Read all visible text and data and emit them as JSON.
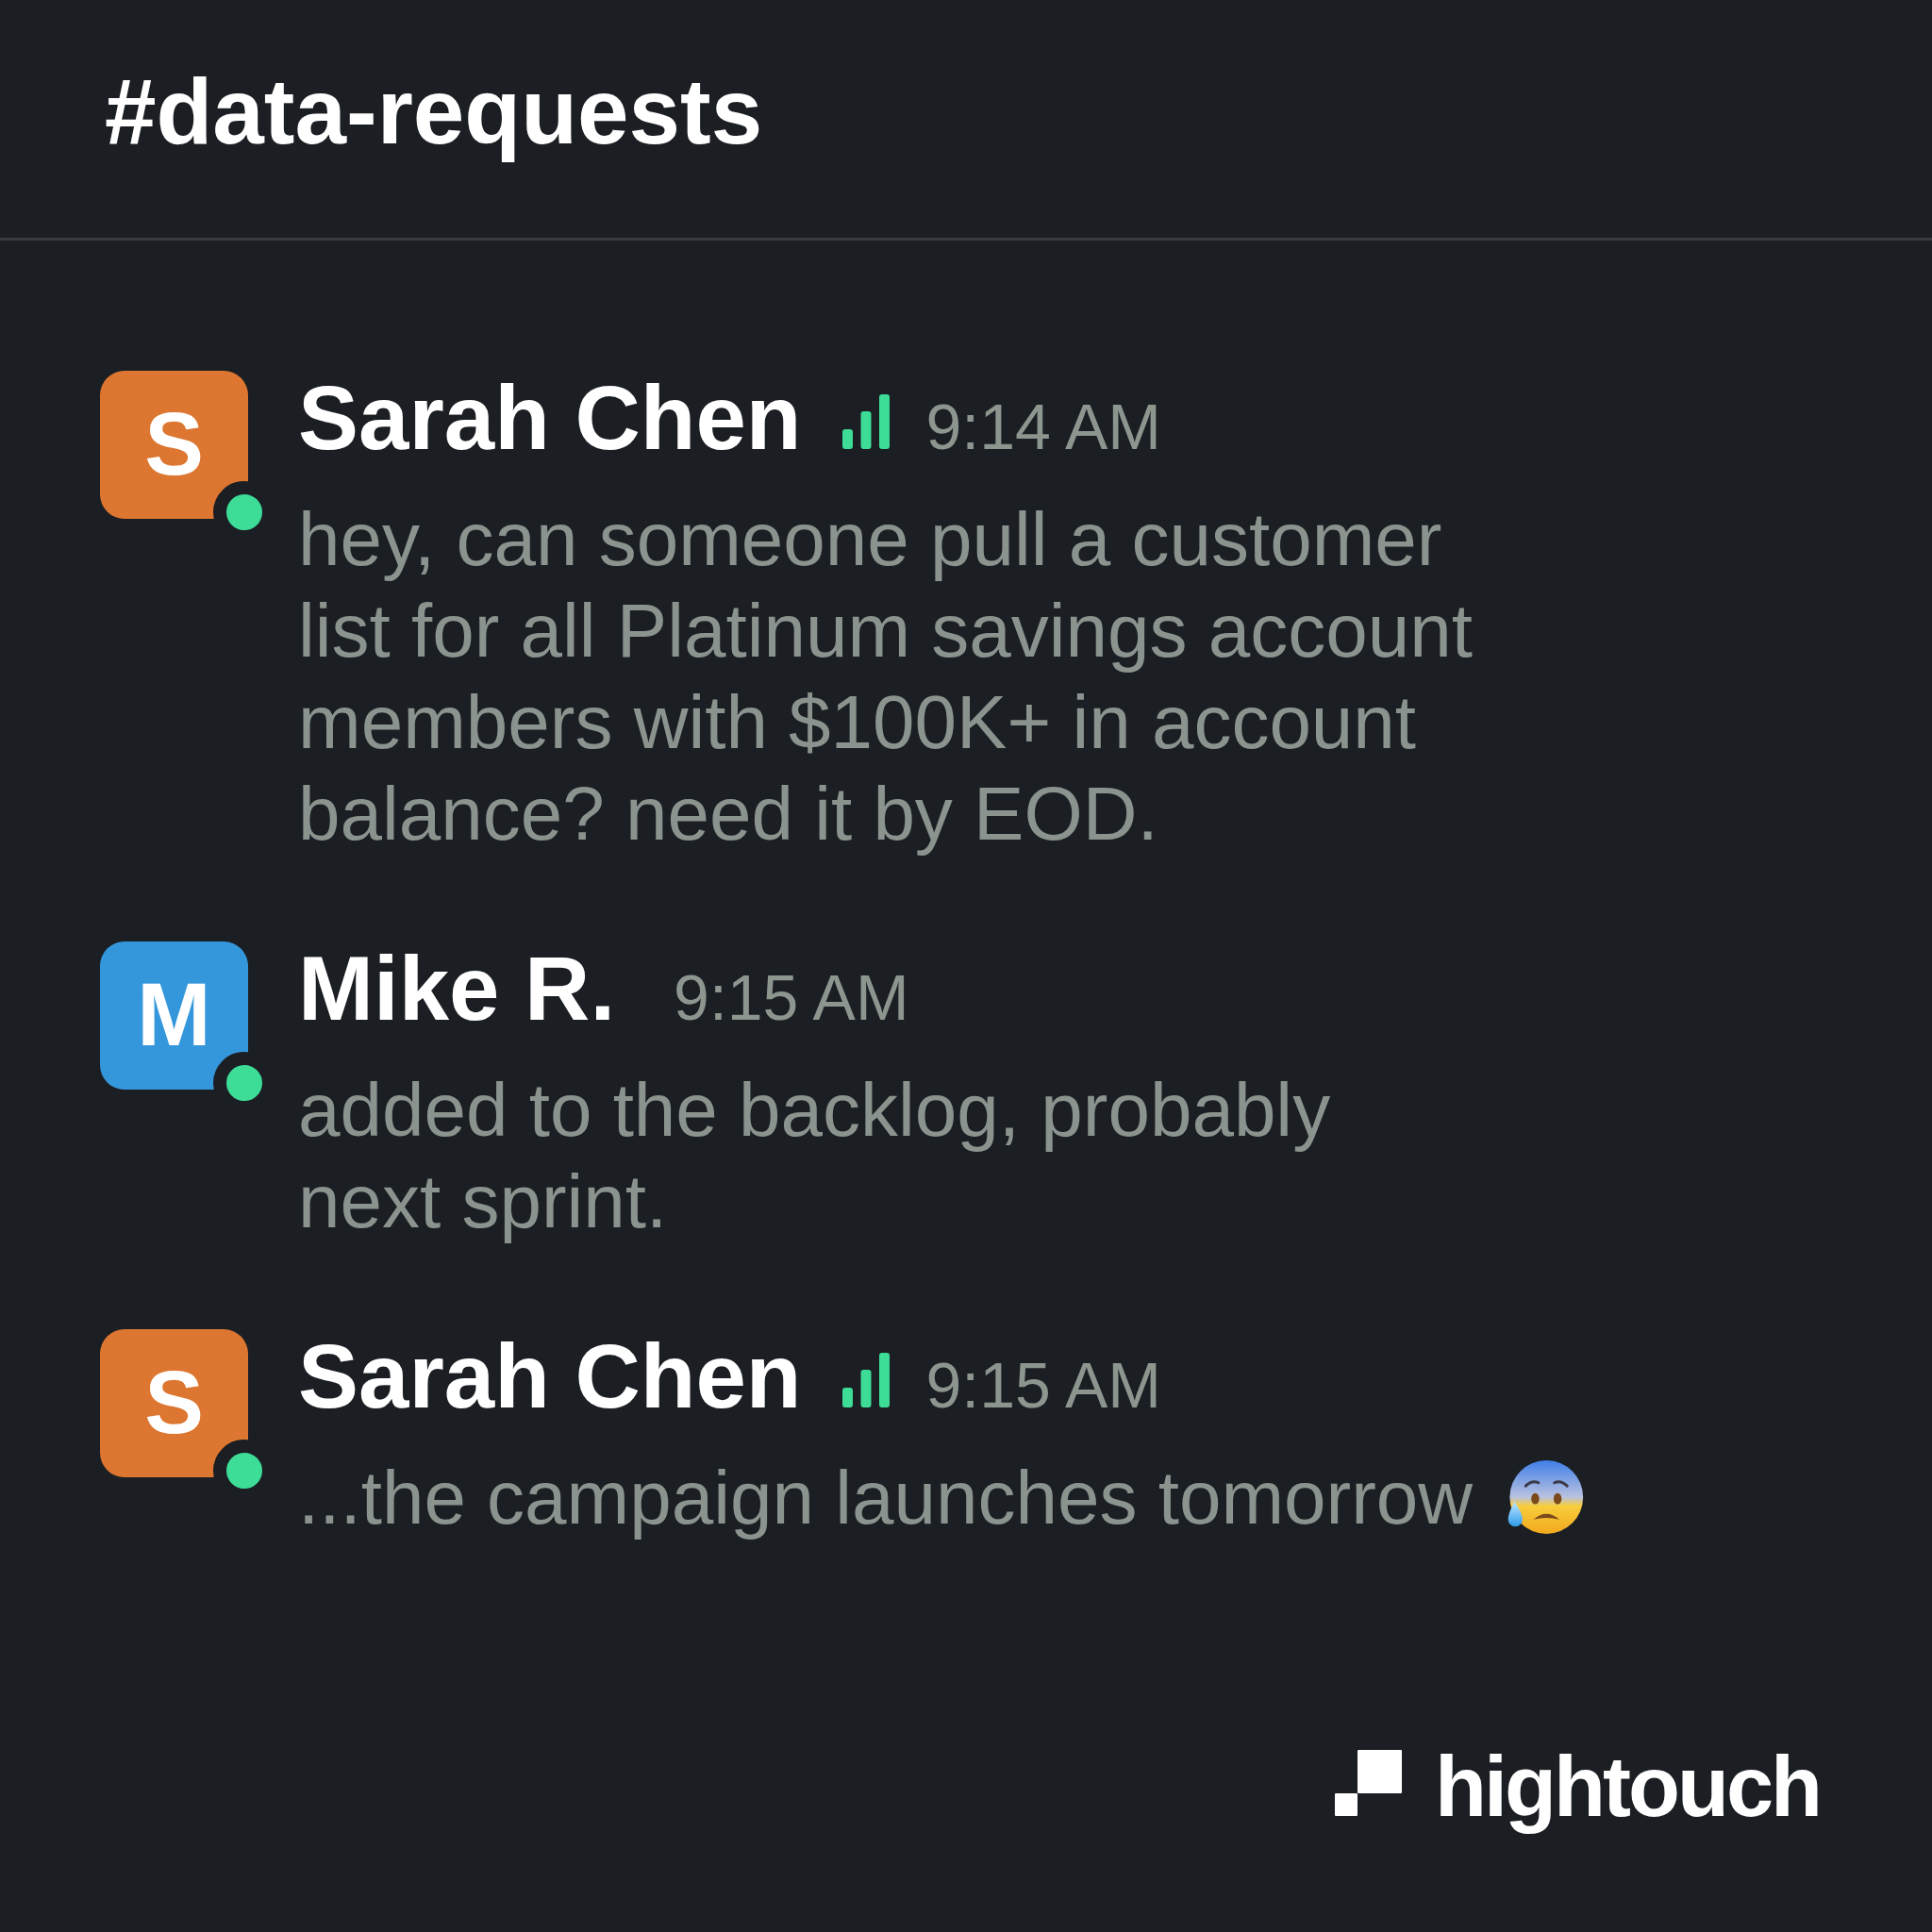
{
  "channel": {
    "title": "#data-requests"
  },
  "messages": [
    {
      "kind": "text",
      "avatar": {
        "initial": "S",
        "color": "#dc7630"
      },
      "online": true,
      "sender": "Sarah Chen",
      "bars_badge": true,
      "time": "9:14 AM",
      "text": "hey, can someone pull a customer list for all Platinum savings account members with $100K+ in account balance? need it by EOD."
    },
    {
      "kind": "text",
      "avatar": {
        "initial": "M",
        "color": "#3597db"
      },
      "online": true,
      "sender": "Mike R.",
      "bars_badge": false,
      "time": "9:15 AM",
      "text": "added to the backlog, probably next sprint."
    },
    {
      "kind": "text-with-emoji",
      "avatar": {
        "initial": "S",
        "color": "#dc7630"
      },
      "online": true,
      "sender": "Sarah Chen",
      "bars_badge": true,
      "time": "9:15 AM",
      "text": "...the campaign launches tomorrow"
    }
  ],
  "logo": {
    "text": "hightouch"
  }
}
